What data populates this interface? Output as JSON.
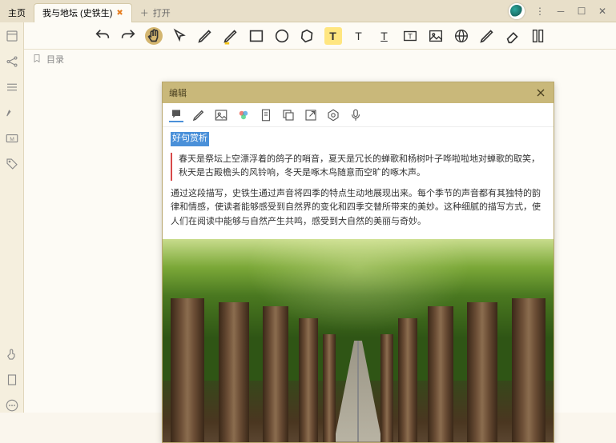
{
  "titlebar": {
    "home_tab": "主页",
    "active_tab": "我与地坛 (史铁生)",
    "new_tab": "打开"
  },
  "sidebar": {
    "toc_label": "目录"
  },
  "editor": {
    "title": "编辑",
    "content_title": "好句赏析",
    "quote": "春天是祭坛上空漂浮着的鸽子的哨音，夏天是冗长的蝉歌和杨树叶子哗啦啦地对蝉歌的取笑，秋天是古殿檐头的风铃响，冬天是啄木鸟随意而空旷的啄木声。",
    "paragraph": "通过这段描写，史铁生通过声音将四季的特点生动地展现出来。每个季节的声音都有其独特的韵律和情感，使读者能够感受到自然界的变化和四季交替所带来的美妙。这种细腻的描写方式，使人们在阅读中能够与自然产生共鸣，感受到大自然的美丽与奇妙。"
  }
}
